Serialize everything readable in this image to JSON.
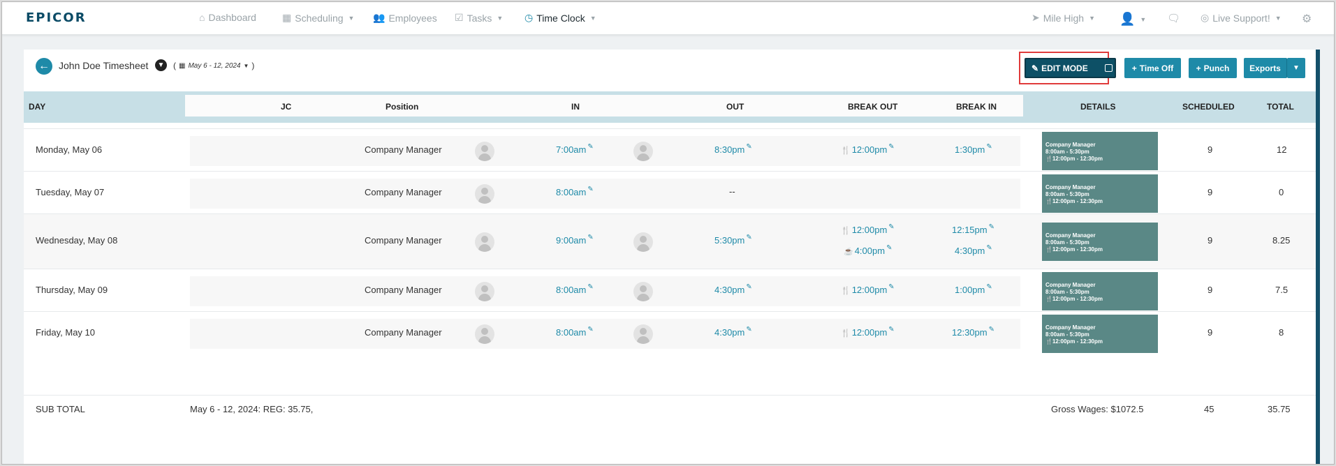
{
  "brand": {
    "logo": "EPICOR",
    "accent": "#1e8aa8",
    "dark": "#0d5066",
    "detail_bg": "#5a8886"
  },
  "nav": {
    "dashboard": {
      "label": "Dashboard",
      "icon": "home-icon"
    },
    "scheduling": {
      "label": "Scheduling",
      "icon": "calendar-icon"
    },
    "employees": {
      "label": "Employees",
      "icon": "users-icon"
    },
    "tasks": {
      "label": "Tasks",
      "icon": "checkbox-icon"
    },
    "timeclock": {
      "label": "Time Clock",
      "icon": "clock-icon"
    },
    "location": {
      "label": "Mile High",
      "icon": "location-arrow-icon"
    },
    "support": {
      "label": "Live Support!",
      "icon": "lifebuoy-icon"
    }
  },
  "timesheet": {
    "title": "John Doe Timesheet",
    "date_range": "May 6 - 12, 2024",
    "paren_open": "(",
    "paren_close": ")"
  },
  "actions": {
    "edit_mode": "EDIT MODE",
    "time_off": "Time Off",
    "punch": "Punch",
    "exports": "Exports"
  },
  "columns": {
    "day": "DAY",
    "jc": "JC",
    "position": "Position",
    "in": "IN",
    "out": "OUT",
    "break_out": "BREAK OUT",
    "break_in": "BREAK IN",
    "details": "DETAILS",
    "scheduled": "SCHEDULED",
    "total": "TOTAL"
  },
  "rows": [
    {
      "day": "Monday, May 06",
      "position": "Company Manager",
      "in": "7:00am",
      "out": "8:30pm",
      "break_out": "12:00pm",
      "break_in": "1:30pm",
      "detail": {
        "role": "Company Manager",
        "shift": "8:00am - 5:30pm",
        "break": "12:00pm - 12:30pm"
      },
      "scheduled": "9",
      "total": "12"
    },
    {
      "day": "Tuesday, May 07",
      "position": "Company Manager",
      "in": "8:00am",
      "out": "--",
      "detail": {
        "role": "Company Manager",
        "shift": "8:00am - 5:30pm",
        "break": "12:00pm - 12:30pm"
      },
      "scheduled": "9",
      "total": "0"
    },
    {
      "day": "Wednesday, May 08",
      "position": "Company Manager",
      "in": "9:00am",
      "out": "5:30pm",
      "break_out": "12:00pm",
      "break_in": "12:15pm",
      "break_out2": "4:00pm",
      "break_in2": "4:30pm",
      "detail": {
        "role": "Company Manager",
        "shift": "8:00am - 5:30pm",
        "break": "12:00pm - 12:30pm"
      },
      "scheduled": "9",
      "total": "8.25"
    },
    {
      "day": "Thursday, May 09",
      "position": "Company Manager",
      "in": "8:00am",
      "out": "4:30pm",
      "break_out": "12:00pm",
      "break_in": "1:00pm",
      "detail": {
        "role": "Company Manager",
        "shift": "8:00am - 5:30pm",
        "break": "12:00pm - 12:30pm"
      },
      "scheduled": "9",
      "total": "7.5"
    },
    {
      "day": "Friday, May 10",
      "position": "Company Manager",
      "in": "8:00am",
      "out": "4:30pm",
      "break_out": "12:00pm",
      "break_in": "12:30pm",
      "detail": {
        "role": "Company Manager",
        "shift": "8:00am - 5:30pm",
        "break": "12:00pm - 12:30pm"
      },
      "scheduled": "9",
      "total": "8"
    }
  ],
  "subtotal": {
    "label": "SUB TOTAL",
    "summary": "May 6 - 12, 2024: REG: 35.75,",
    "gross_wages": "Gross Wages: $1072.5",
    "scheduled": "45",
    "total": "35.75"
  }
}
